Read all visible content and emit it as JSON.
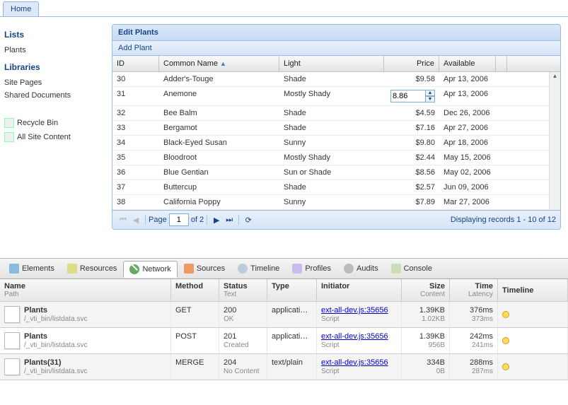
{
  "tab": {
    "home": "Home"
  },
  "sidebar": {
    "lists_hdr": "Lists",
    "plants_link": "Plants",
    "libraries_hdr": "Libraries",
    "site_pages": "Site Pages",
    "shared_docs": "Shared Documents",
    "recycle": "Recycle Bin",
    "all_content": "All Site Content"
  },
  "panel": {
    "title": "Edit Plants",
    "add_btn": "Add Plant",
    "cols": {
      "id": "ID",
      "name": "Common Name",
      "light": "Light",
      "price": "Price",
      "avail": "Available"
    },
    "rows": [
      {
        "id": "30",
        "name": "Adder's-Touge",
        "light": "Shade",
        "price": "$9.58",
        "avail": "Apr 13, 2006"
      },
      {
        "id": "31",
        "name": "Anemone",
        "light": "Mostly Shady",
        "price_edit": "8.86",
        "avail": "Apr 13, 2006"
      },
      {
        "id": "32",
        "name": "Bee Balm",
        "light": "Shade",
        "price": "$4.59",
        "avail": "Dec 26, 2006"
      },
      {
        "id": "33",
        "name": "Bergamot",
        "light": "Shade",
        "price": "$7.16",
        "avail": "Apr 27, 2006"
      },
      {
        "id": "34",
        "name": "Black-Eyed Susan",
        "light": "Sunny",
        "price": "$9.80",
        "avail": "Apr 18, 2006"
      },
      {
        "id": "35",
        "name": "Bloodroot",
        "light": "Mostly Shady",
        "price": "$2.44",
        "avail": "May 15, 2006"
      },
      {
        "id": "36",
        "name": "Blue Gentian",
        "light": "Sun or Shade",
        "price": "$8.56",
        "avail": "May 02, 2006"
      },
      {
        "id": "37",
        "name": "Buttercup",
        "light": "Shade",
        "price": "$2.57",
        "avail": "Jun 09, 2006"
      },
      {
        "id": "38",
        "name": "California Poppy",
        "light": "Sunny",
        "price": "$7.89",
        "avail": "Mar 27, 2006"
      }
    ],
    "pager": {
      "page_lbl": "Page",
      "page": "1",
      "of_lbl": "of 2",
      "info": "Displaying records 1 - 10 of 12"
    }
  },
  "chart_data": {
    "type": "table",
    "title": "Edit Plants",
    "columns": [
      "ID",
      "Common Name",
      "Light",
      "Price",
      "Available"
    ],
    "rows": [
      [
        30,
        "Adder's-Touge",
        "Shade",
        9.58,
        "Apr 13, 2006"
      ],
      [
        31,
        "Anemone",
        "Mostly Shady",
        8.86,
        "Apr 13, 2006"
      ],
      [
        32,
        "Bee Balm",
        "Shade",
        4.59,
        "Dec 26, 2006"
      ],
      [
        33,
        "Bergamot",
        "Shade",
        7.16,
        "Apr 27, 2006"
      ],
      [
        34,
        "Black-Eyed Susan",
        "Sunny",
        9.8,
        "Apr 18, 2006"
      ],
      [
        35,
        "Bloodroot",
        "Mostly Shady",
        2.44,
        "May 15, 2006"
      ],
      [
        36,
        "Blue Gentian",
        "Sun or Shade",
        8.56,
        "May 02, 2006"
      ],
      [
        37,
        "Buttercup",
        "Shade",
        2.57,
        "Jun 09, 2006"
      ],
      [
        38,
        "California Poppy",
        "Sunny",
        7.89,
        "Mar 27, 2006"
      ]
    ]
  },
  "devtools": {
    "tabs": {
      "elements": "Elements",
      "resources": "Resources",
      "network": "Network",
      "sources": "Sources",
      "timeline": "Timeline",
      "profiles": "Profiles",
      "audits": "Audits",
      "console": "Console"
    },
    "net_cols": {
      "name": "Name",
      "name_sub": "Path",
      "method": "Method",
      "status": "Status",
      "status_sub": "Text",
      "type": "Type",
      "initiator": "Initiator",
      "size": "Size",
      "size_sub": "Content",
      "time": "Time",
      "time_sub": "Latency",
      "timeline": "Timeline"
    },
    "requests": [
      {
        "name": "Plants",
        "path": "/_vti_bin/listdata.svc",
        "method": "GET",
        "status": "200",
        "status_t": "OK",
        "type": "application...",
        "init": "ext-all-dev.js:35656",
        "init_t": "Script",
        "size": "1.39KB",
        "size_sub": "1.02KB",
        "time": "376ms",
        "time_sub": "373ms"
      },
      {
        "name": "Plants",
        "path": "/_vti_bin/listdata.svc",
        "method": "POST",
        "status": "201",
        "status_t": "Created",
        "type": "application...",
        "init": "ext-all-dev.js:35656",
        "init_t": "Script",
        "size": "1.39KB",
        "size_sub": "956B",
        "time": "242ms",
        "time_sub": "241ms"
      },
      {
        "name": "Plants(31)",
        "path": "/_vti_bin/listdata.svc",
        "method": "MERGE",
        "status": "204",
        "status_t": "No Content",
        "type": "text/plain",
        "init": "ext-all-dev.js:35656",
        "init_t": "Script",
        "size": "334B",
        "size_sub": "0B",
        "time": "288ms",
        "time_sub": "287ms"
      }
    ]
  }
}
